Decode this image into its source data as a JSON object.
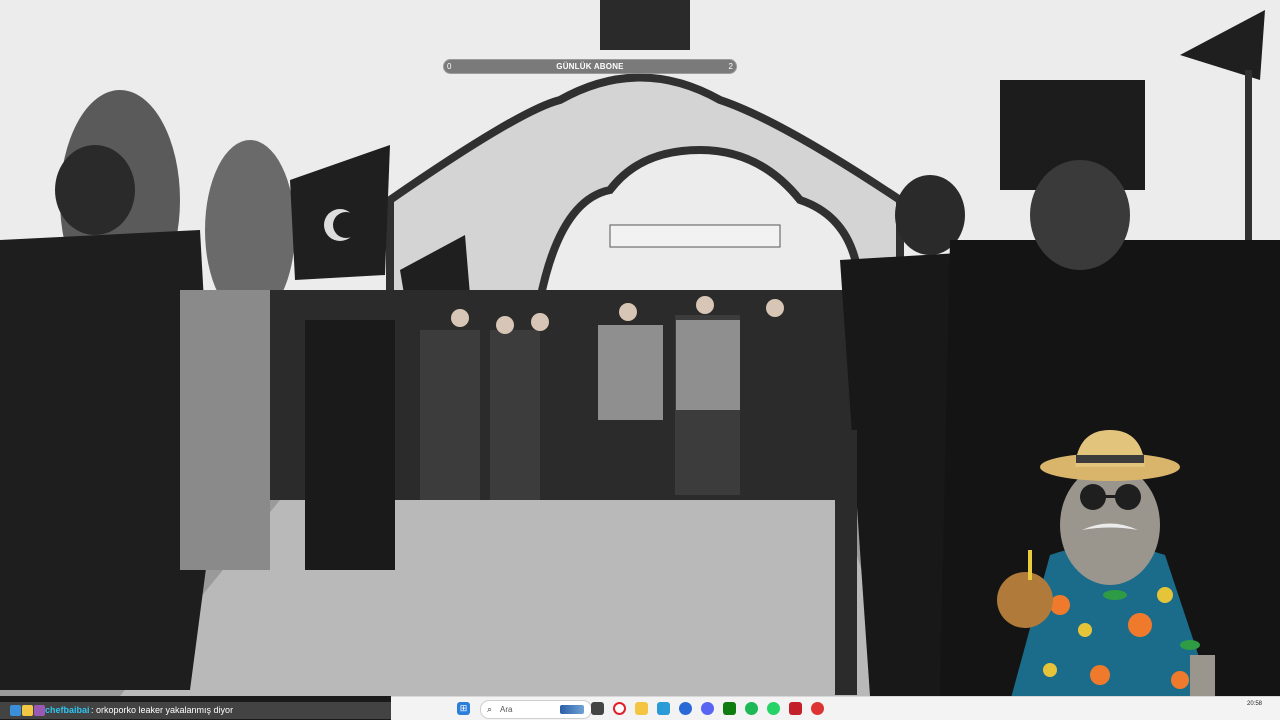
{
  "overlay": {
    "goal": {
      "title": "GÜNLÜK ABONE",
      "min": "0",
      "max": "2"
    }
  },
  "chat": {
    "username": "chefbaibai",
    "message": ": orkoporko leaker yakalanmış diyor",
    "badge_colors": [
      "#3a8fd8",
      "#f2c744",
      "#9b59b6"
    ]
  },
  "taskbar": {
    "search_placeholder": "Ara",
    "time": "20:58",
    "date": "",
    "icons": [
      "windows-start-icon",
      "search-icon",
      "task-view-icon",
      "opera-icon",
      "file-explorer-icon",
      "edge-icon",
      "chrome-icon",
      "discord-icon",
      "xbox-icon",
      "spotify-icon",
      "whatsapp-icon",
      "valorant-icon",
      "app-icon"
    ]
  },
  "colors": {
    "accent_username": "#2ec4f0",
    "taskbar_bg": "#f3f3f3"
  }
}
